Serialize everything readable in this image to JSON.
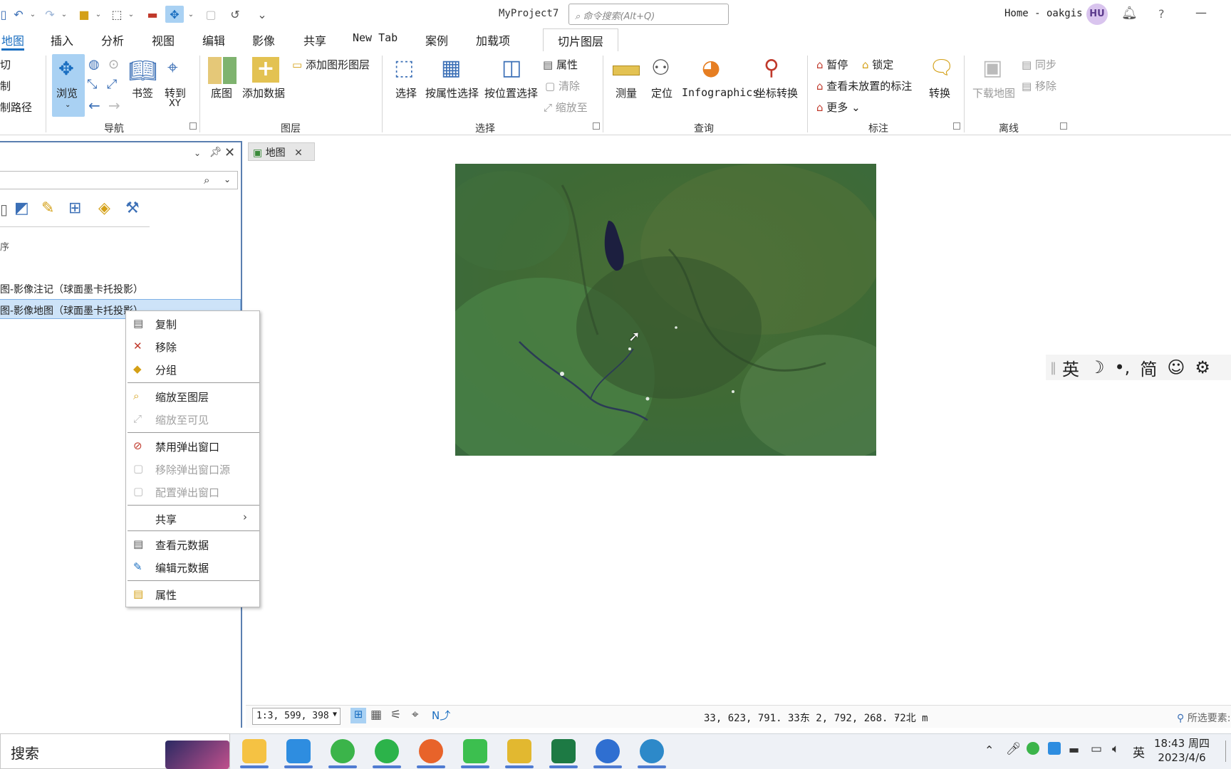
{
  "title_bar": {
    "project_name": "MyProject7",
    "search_placeholder": "命令搜索(Alt+Q)",
    "account": "Home - oakgis",
    "avatar_initials": "HU",
    "help": "?",
    "minimize": "—"
  },
  "menu_tabs": [
    "地图",
    "插入",
    "分析",
    "视图",
    "编辑",
    "影像",
    "共享",
    "New Tab",
    "案例",
    "加载项",
    "切片图层"
  ],
  "ribbon": {
    "clipboard": {
      "cut": "切",
      "copy": "制",
      "copy_path": "制路径"
    },
    "navigation": {
      "explore": "浏览",
      "bookmarks": "书签",
      "goto_xy_1": "转到",
      "goto_xy_2": "XY",
      "group": "导航"
    },
    "layer": {
      "basemap": "底图",
      "add_data": "添加数据",
      "add_graphics_layer": "添加图形图层",
      "group": "图层"
    },
    "selection": {
      "select": "选择",
      "select_by_attributes": "按属性选择",
      "select_by_location": "按位置选择",
      "attributes": "属性",
      "clear": "清除",
      "zoom_to": "缩放至",
      "group": "选择"
    },
    "inquiry": {
      "measure": "测量",
      "locate": "定位",
      "infographics": "Infographics",
      "coordinate_conversion": "坐标转换",
      "group": "查询"
    },
    "labeling": {
      "pause": "暂停",
      "lock": "锁定",
      "view_unplaced": "查看未放置的标注",
      "more": "更多",
      "convert": "转换",
      "group": "标注"
    },
    "offline": {
      "download_map": "下载地图",
      "sync": "同步",
      "remove": "移除",
      "group": "离线"
    }
  },
  "contents_pane": {
    "layer_1": "图-影像注记（球面墨卡托投影）",
    "layer_2": "图-影像地图（球面墨卡托投影）",
    "partial_label": "序"
  },
  "map_tab": {
    "label": "地图"
  },
  "context_menu": {
    "items": [
      "复制",
      "移除",
      "分组",
      "缩放至图层",
      "缩放至可见",
      "禁用弹出窗口",
      "移除弹出窗口源",
      "配置弹出窗口",
      "共享",
      "查看元数据",
      "编辑元数据",
      "属性"
    ]
  },
  "status_bar": {
    "scale": "1:3, 599, 398",
    "coordinates": "33, 623, 791. 33东  2, 792, 268. 72北 m",
    "selected_features": "所选要素:"
  },
  "ime": {
    "lang": "英",
    "moon": "☽",
    "punct": "•,",
    "simplified": "简",
    "emoji": "☺",
    "settings": "⚙"
  },
  "taskbar": {
    "search": "搜索",
    "time": "18:43 周四",
    "date": "2023/4/6",
    "ime_lang": "英"
  },
  "colors": {
    "accent": "#1a6ec0",
    "pane_border": "#5a7fb0",
    "selected_row": "#cde3f8"
  }
}
